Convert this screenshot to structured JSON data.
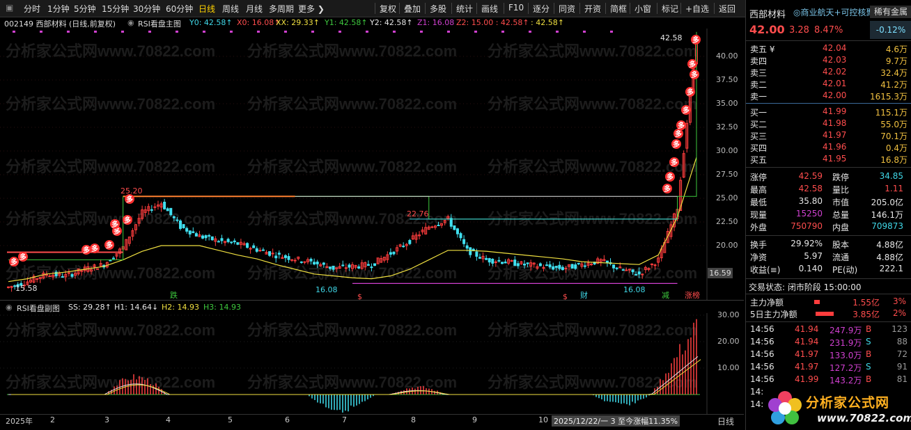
{
  "toolbar": {
    "periods": [
      "分时",
      "1分钟",
      "5分钟",
      "15分钟",
      "30分钟",
      "60分钟",
      "日线",
      "周线",
      "月线",
      "多周期",
      "更多 ❯"
    ],
    "active_period": "日线",
    "tools": [
      "复权",
      "叠加",
      "多股",
      "统计",
      "画线",
      "F10",
      "逐分",
      "同资",
      "开资",
      "简框",
      "小窗",
      "标记",
      "+自选",
      "返回"
    ]
  },
  "main_info": {
    "stock": "002149 西部材料 (日线,前复权)",
    "indicator": "RSI看盘主图",
    "values": [
      {
        "t": "Y0: 42.58↑",
        "c": "#40d8e8"
      },
      {
        "t": "X0: 16.08↑",
        "c": "#ff4d4d"
      },
      {
        "t": "XX: 29.33↑",
        "c": "#f0e040"
      },
      {
        "t": "Y1: 42.58↑",
        "c": "#3ec93e"
      },
      {
        "t": "Y2: 42.58↑",
        "c": "#e6e6e6"
      },
      {
        "t": "Z1: 16.08",
        "c": "#d040d0"
      },
      {
        "t": "Z2: 15.00 : 42.58↑",
        "c": "#ff4d4d"
      },
      {
        "t": ": 42.58↑",
        "c": "#f0e040"
      }
    ]
  },
  "sub_info": {
    "indicator": "RSI看盘副图",
    "values": [
      {
        "t": "SS: 29.28↑",
        "c": "#e6e6e6"
      },
      {
        "t": "H1: 14.64↓",
        "c": "#e6e6e6"
      },
      {
        "t": "H2: 14.93",
        "c": "#f0e040"
      },
      {
        "t": "H3: 14.93",
        "c": "#3ec93e"
      }
    ]
  },
  "watermark": "分析家公式网www.70822.com",
  "main_axis": [
    "40.00",
    "37.50",
    "35.00",
    "32.50",
    "30.00",
    "27.50",
    "25.00",
    "22.50",
    "20.00"
  ],
  "main_axis_current": "16.59",
  "sub_axis": [
    "30.00",
    "20.00",
    "10.00"
  ],
  "x_axis": [
    "2025年",
    "2",
    "3",
    "4",
    "5",
    "6",
    "7",
    "8",
    "9",
    "10"
  ],
  "x_axis_status": "2025/12/22/一 3 至今涨幅11.35%",
  "x_axis_period": "日线",
  "annotations": {
    "high_label": "25.20",
    "low_label": "15.58",
    "mid_high": "22.76",
    "low1": "16.08",
    "low2": "16.08",
    "last_high": "42.58",
    "signals": [
      "跌",
      "$",
      "$",
      "财",
      "减",
      "涨榜"
    ],
    "duo": "多"
  },
  "chart_data": {
    "type": "line",
    "title": "西部材料 日线",
    "y_range": [
      15.0,
      43.0
    ],
    "series": [
      {
        "name": "XX",
        "values": [
          16.2,
          16.5,
          17.0,
          17.2,
          17.5,
          17.8,
          18.5,
          19.4,
          20.0,
          20.0,
          20.0,
          19.5,
          19.0,
          18.6,
          18.0,
          17.5,
          17.0,
          16.8,
          16.6,
          16.5,
          16.8,
          17.5,
          18.5,
          19.5,
          19.5,
          19.4,
          19.2,
          19.0,
          18.8,
          18.6,
          18.3,
          18.2,
          18.1,
          18.0,
          19.0,
          23.0,
          29.33
        ]
      },
      {
        "name": "Y1",
        "values": [
          18.5,
          18.5,
          18.5,
          18.5,
          18.5,
          18.5,
          25.2,
          25.2,
          25.2,
          25.2,
          25.2,
          25.2,
          25.2,
          25.2,
          25.2,
          25.2,
          25.2,
          25.2,
          25.2,
          25.2,
          25.2,
          25.2,
          22.8,
          22.8,
          22.8,
          22.8,
          22.8,
          22.8,
          22.8,
          22.8,
          22.8,
          22.8,
          22.8,
          22.8,
          22.8,
          25.2,
          42.58
        ]
      }
    ],
    "close": [
      15.6,
      16.2,
      17.0,
      16.8,
      17.5,
      18.0,
      19.8,
      23.5,
      24.5,
      22.0,
      21.0,
      20.5,
      20.2,
      19.6,
      19.0,
      18.6,
      18.2,
      17.6,
      17.8,
      18.0,
      19.2,
      20.5,
      22.0,
      22.8,
      19.5,
      18.5,
      18.3,
      18.0,
      17.8,
      17.6,
      18.0,
      18.4,
      17.5,
      17.0,
      18.5,
      24.0,
      42.0
    ],
    "sub_series": {
      "SS_peak": 29.28,
      "H1": 14.64,
      "H2": 14.93,
      "H3": 14.93
    }
  },
  "right_panel": {
    "name": "西部材料",
    "tags": "◎商业航天+可控核聚",
    "sector": "稀有金属",
    "price": "42.00",
    "change": "3.28",
    "change_pct": "8.47%",
    "sector_pct": "-0.12%",
    "asks": [
      {
        "label": "卖五 ¥",
        "price": "42.04",
        "vol": "4.6万"
      },
      {
        "label": "卖四",
        "price": "42.03",
        "vol": "9.7万"
      },
      {
        "label": "卖三",
        "price": "42.02",
        "vol": "32.4万"
      },
      {
        "label": "卖二",
        "price": "42.01",
        "vol": "41.2万"
      },
      {
        "label": "卖一",
        "price": "42.00",
        "vol": "1615.3万"
      }
    ],
    "bids": [
      {
        "label": "买一",
        "price": "41.99",
        "vol": "115.1万"
      },
      {
        "label": "买二",
        "price": "41.98",
        "vol": "55.0万"
      },
      {
        "label": "买三",
        "price": "41.97",
        "vol": "70.1万"
      },
      {
        "label": "买四",
        "price": "41.96",
        "vol": "0.4万"
      },
      {
        "label": "买五",
        "price": "41.95",
        "vol": "16.8万"
      }
    ],
    "stats": [
      {
        "l1": "涨停",
        "v1": "42.59",
        "c1": "red",
        "l2": "跌停",
        "v2": "34.85",
        "c2": "cyan"
      },
      {
        "l1": "最高",
        "v1": "42.58",
        "c1": "red",
        "l2": "量比",
        "v2": "1.11",
        "c2": "red"
      },
      {
        "l1": "最低",
        "v1": "35.80",
        "c1": "wht",
        "l2": "市值",
        "v2": "205.0亿",
        "c2": "wht"
      },
      {
        "l1": "现量",
        "v1": "15250",
        "c1": "mag",
        "l2": "总量",
        "v2": "146.1万",
        "c2": "wht"
      },
      {
        "l1": "外盘",
        "v1": "750790",
        "c1": "red",
        "l2": "内盘",
        "v2": "709873",
        "c2": "cyan"
      }
    ],
    "stats2": [
      {
        "l1": "换手",
        "v1": "29.92%",
        "l2": "股本",
        "v2": "4.88亿"
      },
      {
        "l1": "净资",
        "v1": "5.97",
        "l2": "流通",
        "v2": "4.88亿"
      },
      {
        "l1": "收益(≡)",
        "v1": "0.140",
        "l2": "PE(动)",
        "v2": "222.1"
      }
    ],
    "trade_status": "交易状态: 闭市阶段 15:00:00",
    "flow": [
      {
        "label": "主力净额",
        "val": "1.55亿",
        "pct": "3%"
      },
      {
        "label": "5日主力净额",
        "val": "3.85亿",
        "pct": "2%"
      }
    ],
    "ticks": [
      {
        "t": "14:56",
        "p": "41.94",
        "v": "247.9万",
        "d": "B",
        "n": "123"
      },
      {
        "t": "14:56",
        "p": "41.94",
        "v": "231.9万",
        "d": "S",
        "n": "88"
      },
      {
        "t": "14:56",
        "p": "41.97",
        "v": "133.0万",
        "d": "B",
        "n": "72"
      },
      {
        "t": "14:56",
        "p": "41.97",
        "v": "127.2万",
        "d": "S",
        "n": "91"
      },
      {
        "t": "14:56",
        "p": "41.99",
        "v": "143.2万",
        "d": "B",
        "n": "81"
      },
      {
        "t": "14:",
        "p": "",
        "v": "",
        "d": "",
        "n": ""
      },
      {
        "t": "14:",
        "p": "",
        "v": "",
        "d": "",
        "n": ""
      }
    ],
    "logo_text": "分析家公式网",
    "logo_url": "www.70822.com"
  }
}
